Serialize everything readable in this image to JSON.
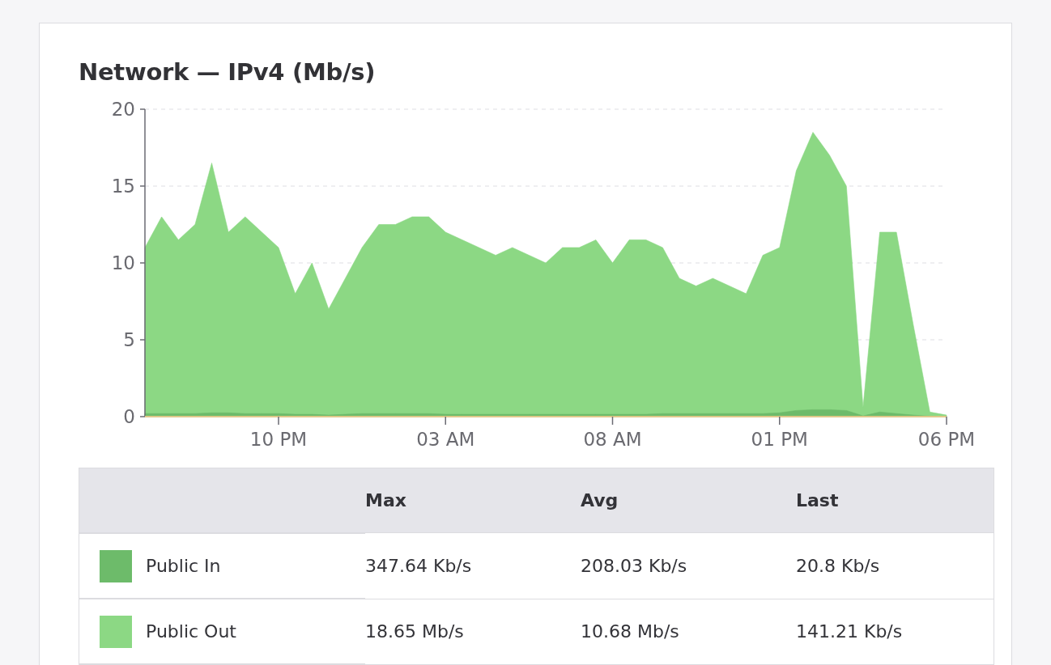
{
  "card": {
    "title": "Network — IPv4 (Mb/s)",
    "chart_data": {
      "type": "area",
      "stacked": false,
      "grid": true,
      "ylim": [
        0,
        20
      ],
      "yticks": [
        0,
        5,
        10,
        15,
        20
      ],
      "categories": [
        null,
        null,
        null,
        null,
        null,
        null,
        null,
        null,
        "10 PM",
        null,
        null,
        null,
        null,
        null,
        null,
        null,
        null,
        null,
        "03 AM",
        null,
        null,
        null,
        null,
        null,
        null,
        null,
        null,
        null,
        "08 AM",
        null,
        null,
        null,
        null,
        null,
        null,
        null,
        null,
        null,
        "01 PM",
        null,
        null,
        null,
        null,
        null,
        null,
        null,
        null,
        null,
        "06 PM"
      ],
      "series": [
        {
          "name": "Public In",
          "color": "#6dbb6a",
          "values": [
            0.2,
            0.2,
            0.2,
            0.2,
            0.25,
            0.25,
            0.2,
            0.2,
            0.2,
            0.15,
            0.15,
            0.1,
            0.15,
            0.2,
            0.2,
            0.2,
            0.2,
            0.2,
            0.15,
            0.15,
            0.15,
            0.15,
            0.15,
            0.15,
            0.15,
            0.15,
            0.15,
            0.15,
            0.15,
            0.15,
            0.15,
            0.2,
            0.2,
            0.2,
            0.2,
            0.2,
            0.2,
            0.2,
            0.25,
            0.4,
            0.45,
            0.45,
            0.4,
            0.05,
            0.3,
            0.2,
            0.1,
            0.03,
            0.02
          ]
        },
        {
          "name": "Public Out",
          "color": "#8cd884",
          "values": [
            11,
            13,
            11.5,
            12.5,
            16.5,
            12,
            13,
            12,
            11,
            8,
            10,
            7,
            9,
            11,
            12.5,
            12.5,
            13,
            13,
            12,
            11.5,
            11,
            10.5,
            11,
            10.5,
            10,
            11,
            11,
            11.5,
            10,
            11.5,
            11.5,
            11,
            9,
            8.5,
            9,
            8.5,
            8,
            10.5,
            11,
            16,
            18.5,
            17,
            15,
            0.6,
            12,
            12,
            6,
            0.3,
            0.1
          ]
        }
      ]
    },
    "table": {
      "columns": [
        "Max",
        "Avg",
        "Last"
      ],
      "rows": [
        {
          "max": "347.64 Kb/s",
          "avg": "208.03 Kb/s",
          "last": "20.8 Kb/s"
        },
        {
          "max": "18.65 Mb/s",
          "avg": "10.68 Mb/s",
          "last": "141.21 Kb/s"
        }
      ]
    }
  }
}
